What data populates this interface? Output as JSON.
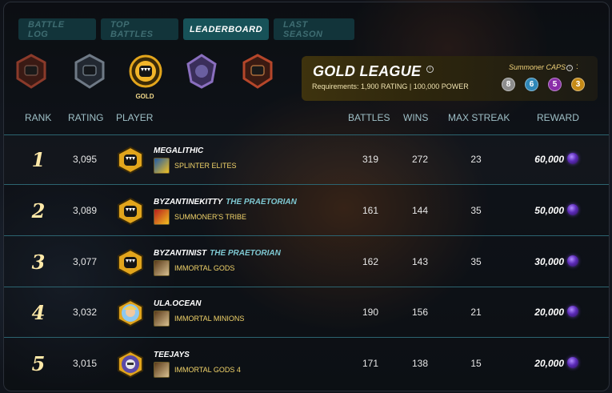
{
  "tabs": [
    {
      "label": "Battle Log",
      "active": false
    },
    {
      "label": "Top Battles",
      "active": false
    },
    {
      "label": "Leaderboard",
      "active": true
    },
    {
      "label": "Last Season",
      "active": false
    }
  ],
  "badges": {
    "selected_label": "GOLD",
    "colors": {
      "bronze": "#8a3a2a",
      "silver": "#6f7a86",
      "gold": "#e2a51c",
      "diamond": "#8a6fbf",
      "champion": "#b5462a"
    }
  },
  "league": {
    "title": "GOLD LEAGUE",
    "requirements": "Requirements: 1,900 RATING | 100,000 POWER",
    "caps_label": "Summoner CAPS",
    "caps_colon": ":",
    "caps": [
      {
        "value": "8",
        "color": "#8d8d8d"
      },
      {
        "value": "6",
        "color": "#2f87b8"
      },
      {
        "value": "5",
        "color": "#8a2ea8"
      },
      {
        "value": "3",
        "color": "#c58a16"
      }
    ]
  },
  "headers": {
    "rank": "RANK",
    "rating": "RATING",
    "player": "PLAYER",
    "battles": "BATTLES",
    "wins": "WINS",
    "max_streak": "MAX STREAK",
    "reward": "REWARD"
  },
  "rows": [
    {
      "rank": "1",
      "rating": "3,095",
      "player": "MEGALITHIC",
      "title": "",
      "guild": "SPLINTER ELITES",
      "battles": "319",
      "wins": "272",
      "streak": "23",
      "reward": "60,000",
      "avatar": "gold-league-avatar"
    },
    {
      "rank": "2",
      "rating": "3,089",
      "player": "BYZANTINEKITTY",
      "title": "THE PRAETORIAN",
      "guild": "SUMMONER'S TRIBE",
      "battles": "161",
      "wins": "144",
      "streak": "35",
      "reward": "50,000",
      "avatar": "gold-league-avatar"
    },
    {
      "rank": "3",
      "rating": "3,077",
      "player": "BYZANTINIST",
      "title": "THE PRAETORIAN",
      "guild": "IMMORTAL GODS",
      "battles": "162",
      "wins": "143",
      "streak": "35",
      "reward": "30,000",
      "avatar": "gold-league-avatar"
    },
    {
      "rank": "4",
      "rating": "3,032",
      "player": "ULA.OCEAN",
      "title": "",
      "guild": "IMMORTAL MINIONS",
      "battles": "190",
      "wins": "156",
      "streak": "21",
      "reward": "20,000",
      "avatar": "custom-avatar"
    },
    {
      "rank": "5",
      "rating": "3,015",
      "player": "TEEJAYS",
      "title": "",
      "guild": "IMMORTAL GODS 4",
      "battles": "171",
      "wins": "138",
      "streak": "15",
      "reward": "20,000",
      "avatar": "custom-avatar"
    }
  ]
}
